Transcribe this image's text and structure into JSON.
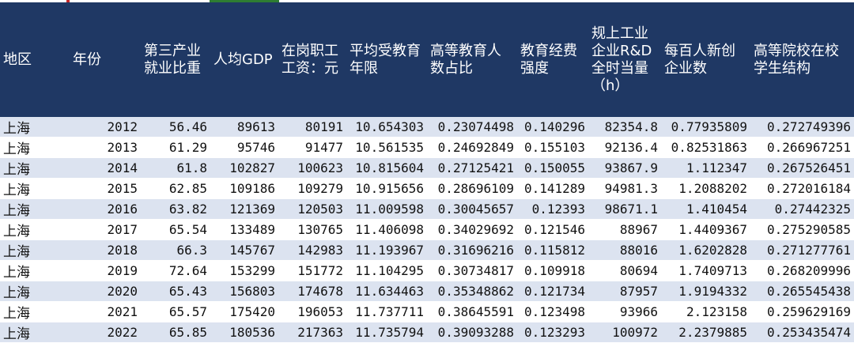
{
  "headers": [
    "地区",
    "年份",
    "第三产业就业比重",
    "人均GDP",
    "在岗职工工资：元",
    "平均受教育年限",
    "高等教育人数占比",
    "教育经费强度",
    "规上工业企业R&D全时当量（h）",
    "每百人新创企业数",
    "高等院校在校学生结构"
  ],
  "rows": [
    [
      "上海",
      "2012",
      "56.46",
      "89613",
      "80191",
      "10.654303",
      "0.23074498",
      "0.140296",
      "82354.8",
      "0.77935809",
      "0.272749396"
    ],
    [
      "上海",
      "2013",
      "61.29",
      "95746",
      "91477",
      "10.561535",
      "0.24692849",
      "0.155103",
      "92136.4",
      "0.82531863",
      "0.266967251"
    ],
    [
      "上海",
      "2014",
      "61.8",
      "102827",
      "100623",
      "10.815604",
      "0.27125421",
      "0.150055",
      "93867.9",
      "1.112347",
      "0.267526451"
    ],
    [
      "上海",
      "2015",
      "62.85",
      "109186",
      "109279",
      "10.915656",
      "0.28696109",
      "0.141289",
      "94981.3",
      "1.2088202",
      "0.272016184"
    ],
    [
      "上海",
      "2016",
      "63.82",
      "121369",
      "120503",
      "11.009598",
      "0.30045657",
      "0.12393",
      "98671.1",
      "1.410454",
      "0.27442325"
    ],
    [
      "上海",
      "2017",
      "65.54",
      "133489",
      "130765",
      "11.406098",
      "0.34029692",
      "0.121546",
      "88967",
      "1.4409367",
      "0.275290585"
    ],
    [
      "上海",
      "2018",
      "66.3",
      "145767",
      "142983",
      "11.193967",
      "0.31696216",
      "0.115812",
      "88016",
      "1.6202828",
      "0.271277761"
    ],
    [
      "上海",
      "2019",
      "72.64",
      "153299",
      "151772",
      "11.104295",
      "0.30734817",
      "0.109918",
      "80694",
      "1.7409713",
      "0.268209996"
    ],
    [
      "上海",
      "2020",
      "65.43",
      "156803",
      "174678",
      "11.634463",
      "0.35348862",
      "0.121734",
      "87957",
      "1.9194332",
      "0.265545438"
    ],
    [
      "上海",
      "2021",
      "65.57",
      "175420",
      "196053",
      "11.737711",
      "0.38645591",
      "0.123498",
      "93966",
      "2.123158",
      "0.259629169"
    ],
    [
      "上海",
      "2022",
      "65.85",
      "180536",
      "217363",
      "11.735794",
      "0.39093288",
      "0.123293",
      "100972",
      "2.2379885",
      "0.253435474"
    ]
  ]
}
